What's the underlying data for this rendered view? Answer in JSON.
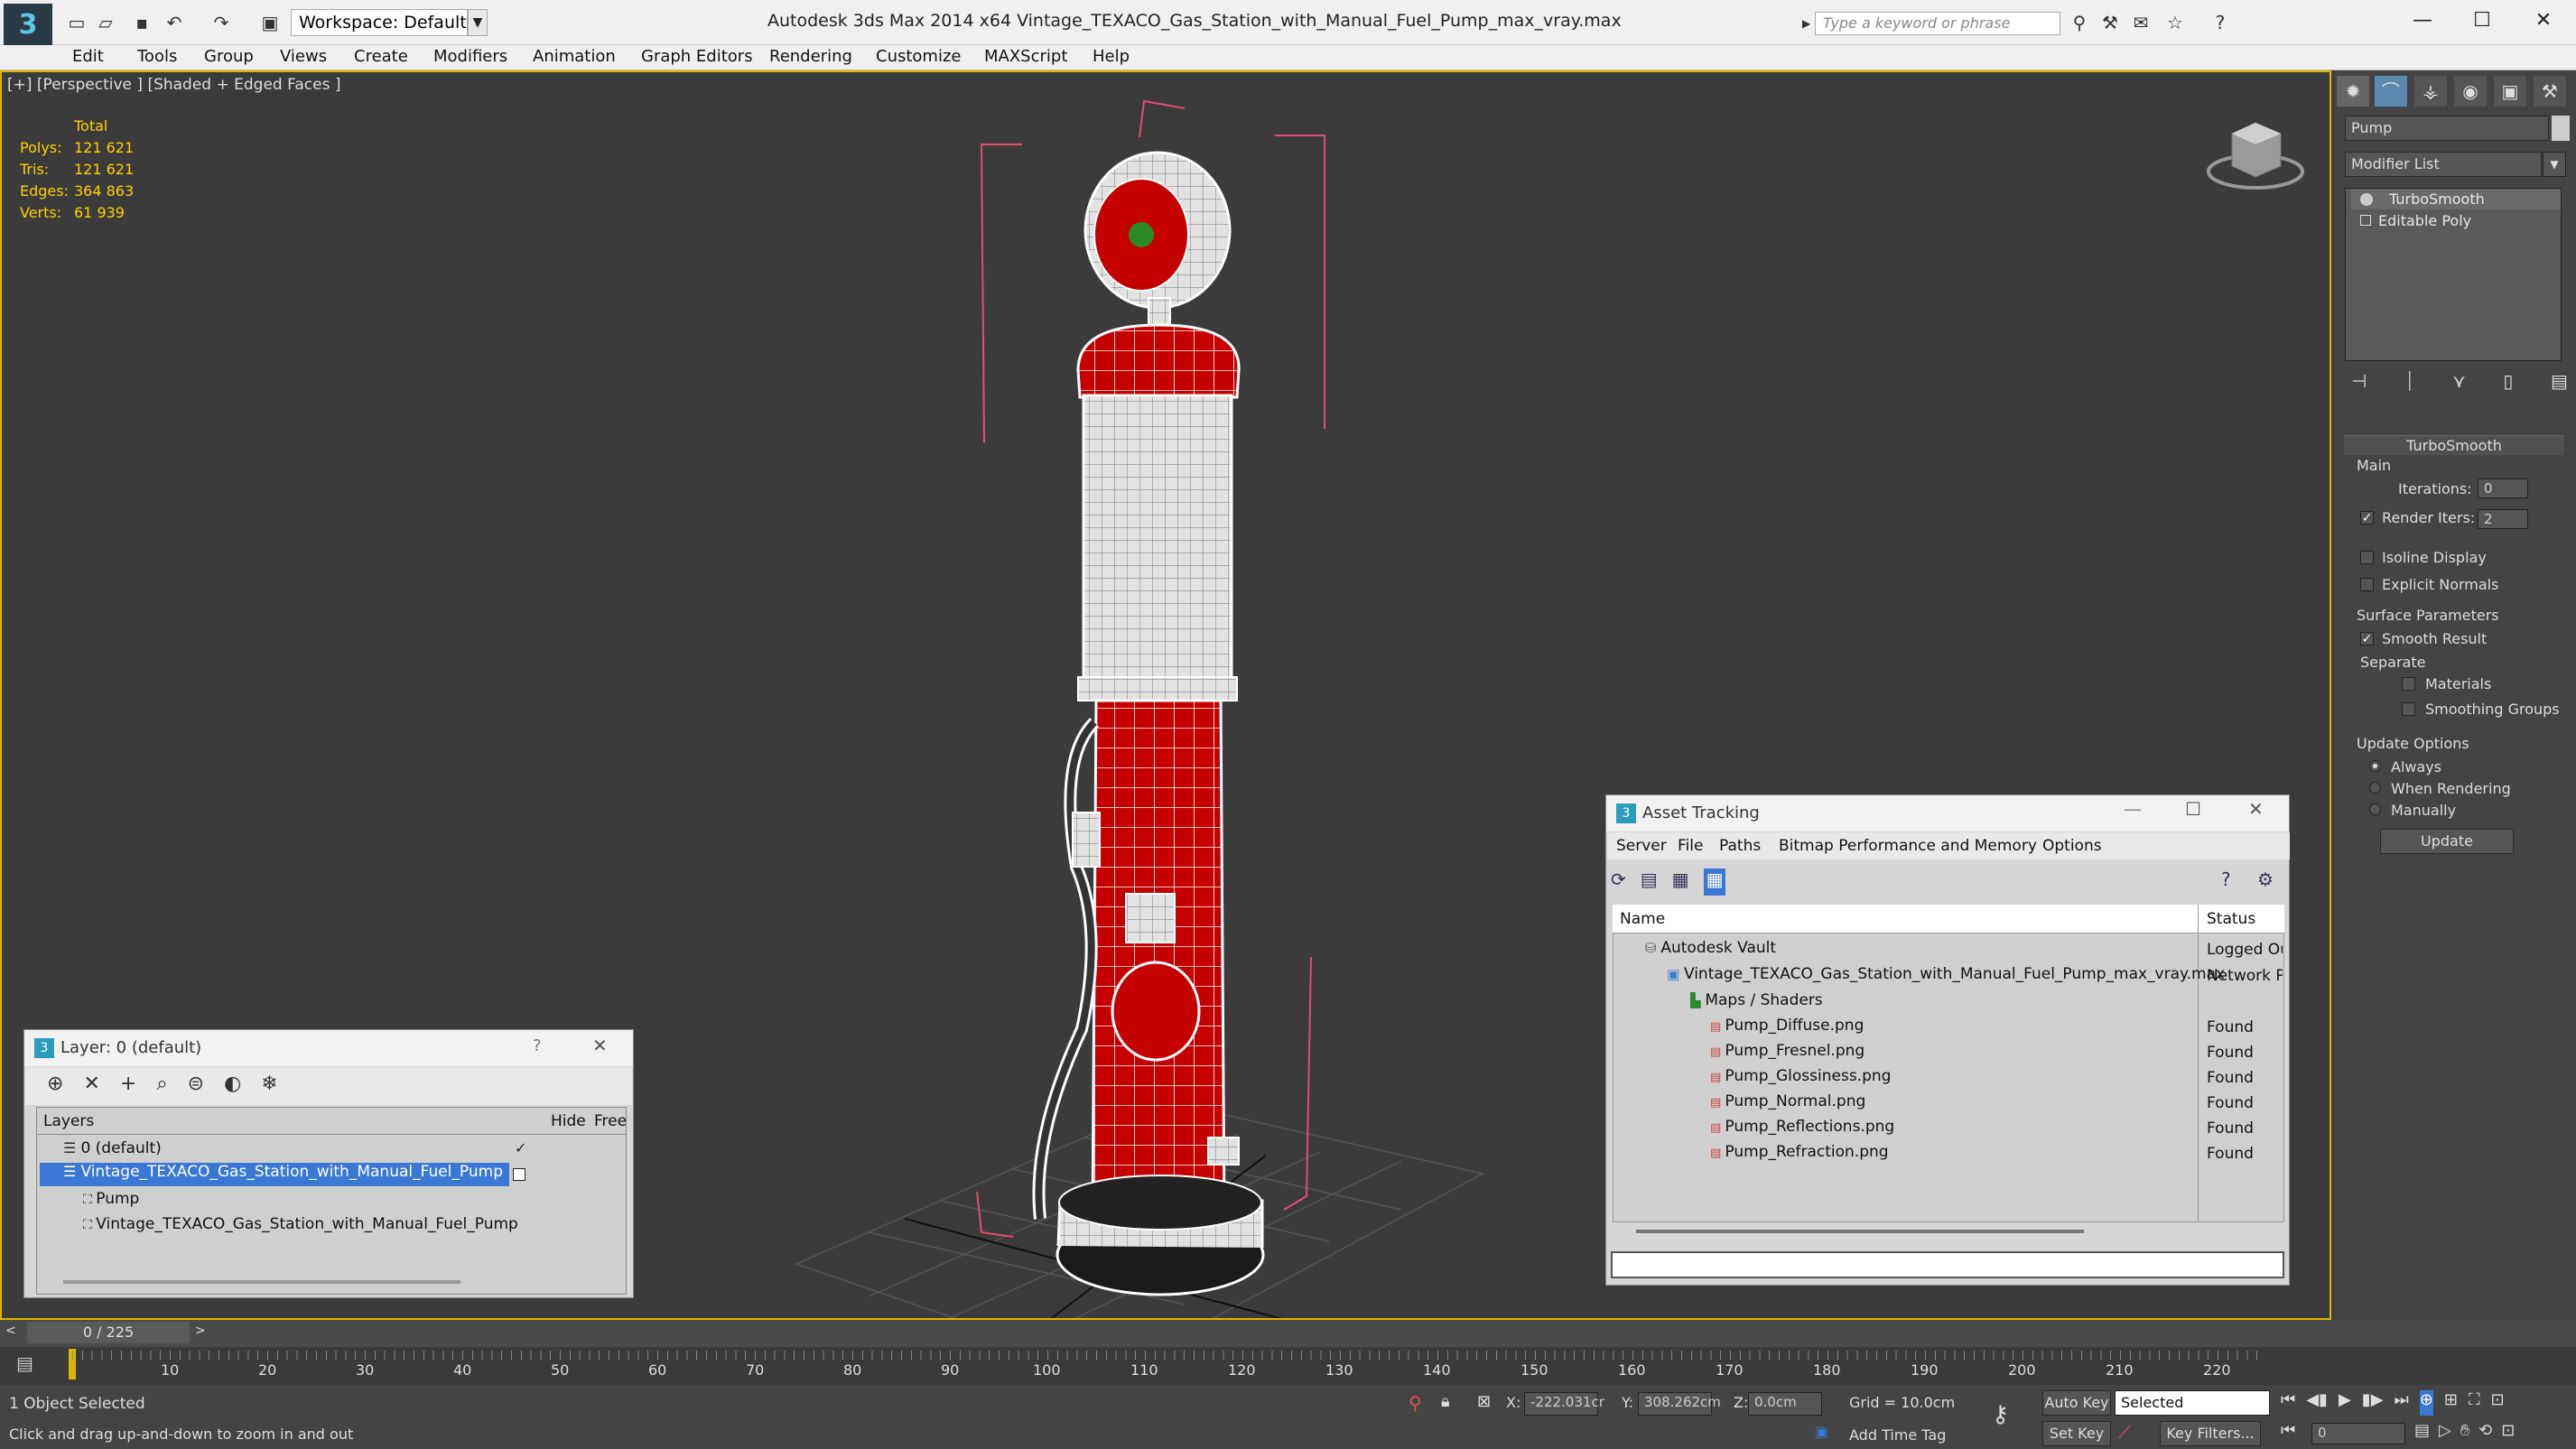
{
  "window": {
    "title": "Autodesk 3ds Max  2014 x64      Vintage_TEXACO_Gas_Station_with_Manual_Fuel_Pump_max_vray.max",
    "workspace": "Workspace: Default",
    "search_placeholder": "Type a keyword or phrase"
  },
  "menu": [
    "Edit",
    "Tools",
    "Group",
    "Views",
    "Create",
    "Modifiers",
    "Animation",
    "Graph Editors",
    "Rendering",
    "Customize",
    "MAXScript",
    "Help"
  ],
  "viewport": {
    "label": "[+] [Perspective ] [Shaded + Edged Faces ]",
    "stats": {
      "header": "Total",
      "rows": [
        {
          "label": "Polys:",
          "value": "121 621"
        },
        {
          "label": "Tris:",
          "value": "121 621"
        },
        {
          "label": "Edges:",
          "value": "364 863"
        },
        {
          "label": "Verts:",
          "value": "61 939"
        }
      ]
    }
  },
  "command_panel": {
    "object_name": "Pump",
    "modifier_list": "Modifier List",
    "stack": [
      "TurboSmooth",
      "Editable Poly"
    ],
    "rollout_title": "TurboSmooth",
    "main_label": "Main",
    "iterations_label": "Iterations:",
    "iterations_value": "0",
    "render_iters_label": "Render Iters:",
    "render_iters_value": "2",
    "isoline": "Isoline Display",
    "explicit_normals": "Explicit Normals",
    "surface_params": "Surface Parameters",
    "smooth_result": "Smooth Result",
    "separate": "Separate",
    "materials": "Materials",
    "smoothing_groups": "Smoothing Groups",
    "update_options": "Update Options",
    "always": "Always",
    "when_rendering": "When Rendering",
    "manually": "Manually",
    "update_button": "Update"
  },
  "layer_window": {
    "title": "Layer: 0 (default)",
    "help": "?",
    "col_layers": "Layers",
    "col_hide": "Hide",
    "col_freeze": "Free",
    "rows": [
      {
        "name": "0 (default)"
      },
      {
        "name": "Vintage_TEXACO_Gas_Station_with_Manual_Fuel_Pump"
      },
      {
        "name": "Pump"
      },
      {
        "name": "Vintage_TEXACO_Gas_Station_with_Manual_Fuel_Pump"
      }
    ]
  },
  "asset_window": {
    "title": "Asset Tracking",
    "menu": [
      "Server",
      "File",
      "Paths",
      "Bitmap Performance and Memory",
      "Options"
    ],
    "col_name": "Name",
    "col_status": "Status",
    "rows": [
      {
        "name": "Autodesk Vault",
        "status": "Logged Ou"
      },
      {
        "name": "Vintage_TEXACO_Gas_Station_with_Manual_Fuel_Pump_max_vray.max",
        "status": "Network Pa"
      },
      {
        "name": "Maps / Shaders",
        "status": ""
      },
      {
        "name": "Pump_Diffuse.png",
        "status": "Found"
      },
      {
        "name": "Pump_Fresnel.png",
        "status": "Found"
      },
      {
        "name": "Pump_Glossiness.png",
        "status": "Found"
      },
      {
        "name": "Pump_Normal.png",
        "status": "Found"
      },
      {
        "name": "Pump_Reflections.png",
        "status": "Found"
      },
      {
        "name": "Pump_Refraction.png",
        "status": "Found"
      }
    ]
  },
  "timeline": {
    "frame": "0 / 225",
    "ticks": [
      "10",
      "20",
      "30",
      "40",
      "50",
      "60",
      "70",
      "80",
      "90",
      "100",
      "110",
      "120",
      "130",
      "140",
      "150",
      "160",
      "170",
      "180",
      "190",
      "200",
      "210",
      "220"
    ]
  },
  "status": {
    "selected": "1 Object Selected",
    "prompt": "Click and drag up-and-down to zoom in and out",
    "x_label": "X:",
    "x_value": "-222.031cr",
    "y_label": "Y:",
    "y_value": "308.262cm",
    "z_label": "Z:",
    "z_value": "0.0cm",
    "grid": "Grid = 10.0cm",
    "add_time_tag": "Add Time Tag",
    "auto_key": "Auto Key",
    "set_key": "Set Key",
    "selected_dropdown": "Selected",
    "key_filters": "Key Filters...",
    "frame_field": "0"
  },
  "colors": {
    "viewport_border": "#d8b800",
    "stats_text": "#ffd200",
    "wire_red": "#d40000",
    "selection_blue": "#3a78d4"
  }
}
